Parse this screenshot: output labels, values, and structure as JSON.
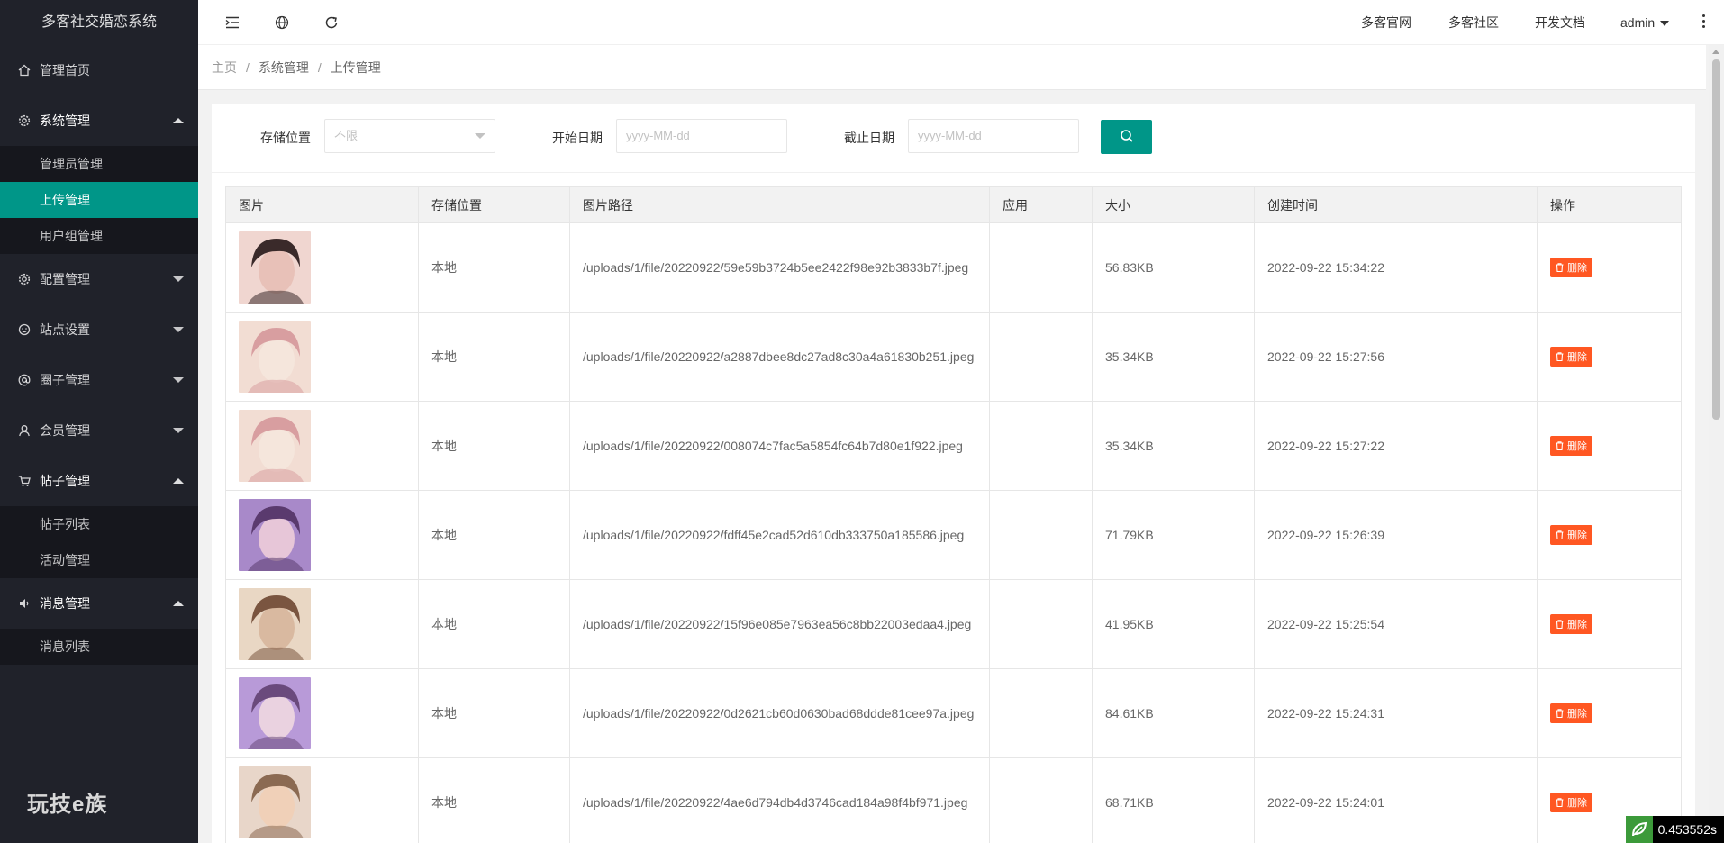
{
  "app": {
    "title": "多客社交婚恋系统",
    "brand": "玩技e族"
  },
  "sidebar": {
    "items": [
      {
        "label": "管理首页",
        "icon": "home-icon",
        "expandable": false
      },
      {
        "label": "系统管理",
        "icon": "gear-icon",
        "expandable": true,
        "open": true,
        "children": [
          {
            "label": "管理员管理"
          },
          {
            "label": "上传管理",
            "active": true
          },
          {
            "label": "用户组管理"
          }
        ]
      },
      {
        "label": "配置管理",
        "icon": "gear-icon",
        "expandable": true,
        "open": false
      },
      {
        "label": "站点设置",
        "icon": "smile-icon",
        "expandable": true,
        "open": false
      },
      {
        "label": "圈子管理",
        "icon": "at-icon",
        "expandable": true,
        "open": false
      },
      {
        "label": "会员管理",
        "icon": "user-icon",
        "expandable": true,
        "open": false
      },
      {
        "label": "帖子管理",
        "icon": "cart-icon",
        "expandable": true,
        "open": true,
        "children": [
          {
            "label": "帖子列表"
          },
          {
            "label": "活动管理"
          }
        ]
      },
      {
        "label": "消息管理",
        "icon": "speaker-icon",
        "expandable": true,
        "open": true,
        "children": [
          {
            "label": "消息列表"
          }
        ]
      }
    ]
  },
  "header": {
    "icons": [
      "menu-fold-icon",
      "globe-icon",
      "refresh-icon"
    ],
    "links": [
      "多客官网",
      "多客社区",
      "开发文档"
    ],
    "user": "admin"
  },
  "breadcrumb": [
    "主页",
    "系统管理",
    "上传管理"
  ],
  "filters": {
    "storage_label": "存储位置",
    "storage_value": "不限",
    "start_label": "开始日期",
    "start_placeholder": "yyyy-MM-dd",
    "end_label": "截止日期",
    "end_placeholder": "yyyy-MM-dd"
  },
  "table": {
    "columns": [
      "图片",
      "存储位置",
      "图片路径",
      "应用",
      "大小",
      "创建时间",
      "操作"
    ],
    "rows": [
      {
        "storage": "本地",
        "path": "/uploads/1/file/20220922/59e59b3724b5ee2422f98e92b3833b7f.jpeg",
        "app": "",
        "size": "56.83KB",
        "created": "2022-09-22 15:34:22",
        "action": "删除"
      },
      {
        "storage": "本地",
        "path": "/uploads/1/file/20220922/a2887dbee8dc27ad8c30a4a61830b251.jpeg",
        "app": "",
        "size": "35.34KB",
        "created": "2022-09-22 15:27:56",
        "action": "删除"
      },
      {
        "storage": "本地",
        "path": "/uploads/1/file/20220922/008074c7fac5a5854fc64b7d80e1f922.jpeg",
        "app": "",
        "size": "35.34KB",
        "created": "2022-09-22 15:27:22",
        "action": "删除"
      },
      {
        "storage": "本地",
        "path": "/uploads/1/file/20220922/fdff45e2cad52d610db333750a185586.jpeg",
        "app": "",
        "size": "71.79KB",
        "created": "2022-09-22 15:26:39",
        "action": "删除"
      },
      {
        "storage": "本地",
        "path": "/uploads/1/file/20220922/15f96e085e7963ea56c8bb22003edaa4.jpeg",
        "app": "",
        "size": "41.95KB",
        "created": "2022-09-22 15:25:54",
        "action": "删除"
      },
      {
        "storage": "本地",
        "path": "/uploads/1/file/20220922/0d2621cb60d0630bad68ddde81cee97a.jpeg",
        "app": "",
        "size": "84.61KB",
        "created": "2022-09-22 15:24:31",
        "action": "删除"
      },
      {
        "storage": "本地",
        "path": "/uploads/1/file/20220922/4ae6d794db4d3746cad184a98f4bf971.jpeg",
        "app": "",
        "size": "68.71KB",
        "created": "2022-09-22 15:24:01",
        "action": "删除"
      }
    ]
  },
  "timer": {
    "value": "0.453552s"
  },
  "colors": {
    "accent": "#009688",
    "sidebar_bg": "#20222a",
    "danger": "#ff5722"
  }
}
